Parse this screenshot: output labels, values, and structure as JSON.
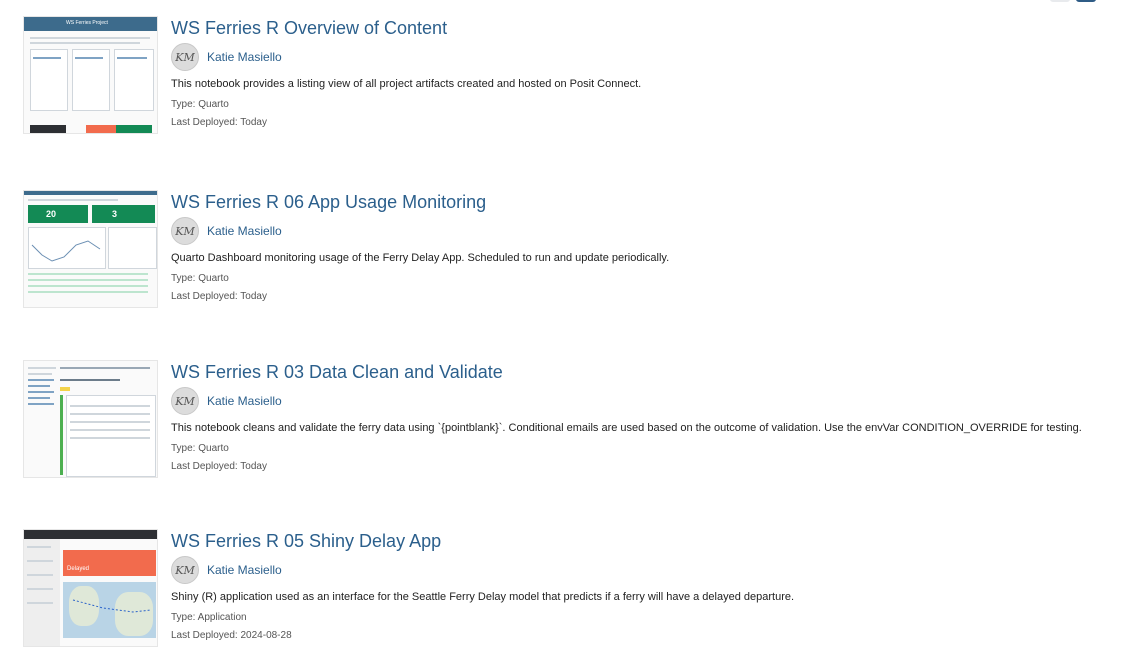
{
  "items": [
    {
      "title": "WS Ferries R Overview of Content",
      "author_initials": "KM",
      "author": "Katie Masiello",
      "description": "This notebook provides a listing view of all project artifacts created and hosted on Posit Connect.",
      "type": "Type: Quarto",
      "deployed": "Last Deployed: Today",
      "thumb_header": "WS Ferries Project"
    },
    {
      "title": "WS Ferries R 06 App Usage Monitoring",
      "author_initials": "KM",
      "author": "Katie Masiello",
      "description": "Quarto Dashboard monitoring usage of the Ferry Delay App. Scheduled to run and update periodically.",
      "type": "Type: Quarto",
      "deployed": "Last Deployed: Today",
      "thumb_stat1": "20",
      "thumb_stat2": "3"
    },
    {
      "title": "WS Ferries R 03 Data Clean and Validate",
      "author_initials": "KM",
      "author": "Katie Masiello",
      "description": "This notebook cleans and validate the ferry data using `{pointblank}`. Conditional emails are used based on the outcome of validation. Use the envVar CONDITION_OVERRIDE for testing.",
      "type": "Type: Quarto",
      "deployed": "Last Deployed: Today"
    },
    {
      "title": "WS Ferries R 05 Shiny Delay App",
      "author_initials": "KM",
      "author": "Katie Masiello",
      "description": "Shiny (R) application used as an interface for the Seattle Ferry Delay model that predicts if a ferry will have a delayed departure.",
      "type": "Type: Application",
      "deployed": "Last Deployed: 2024-08-28",
      "thumb_banner": "Delayed"
    }
  ],
  "colors": {
    "link": "#2b5f8c",
    "green": "#138a55",
    "orange": "#f26b4d",
    "header_blue": "#3d6b8c"
  }
}
